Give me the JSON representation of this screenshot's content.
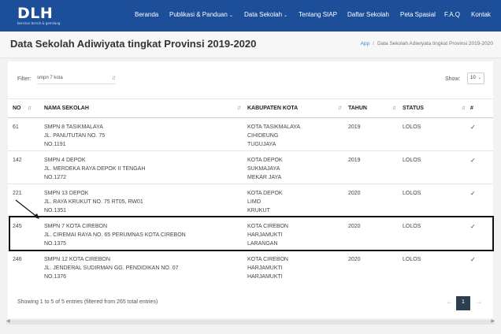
{
  "navbar": {
    "logo_main": "DLH",
    "logo_sub": "bersinar bersih & gemilang",
    "items": [
      {
        "label": "Beranda",
        "dropdown": false
      },
      {
        "label": "Publikasi & Panduan",
        "dropdown": true
      },
      {
        "label": "Data Sekolah",
        "dropdown": true
      },
      {
        "label": "Tentang SIAP",
        "dropdown": false
      },
      {
        "label": "Daftar Sekolah",
        "dropdown": false
      },
      {
        "label": "Peta Spasial",
        "dropdown": false
      },
      {
        "label": "F.A.Q",
        "dropdown": false
      },
      {
        "label": "Kontak",
        "dropdown": false
      }
    ]
  },
  "header": {
    "title": "Data Sekolah Adiwiyata tingkat Provinsi 2019-2020",
    "breadcrumb": [
      "App",
      "Data Sekolah Adiwiyata tingkat Provinsi 2019-2020"
    ]
  },
  "filter": {
    "label": "Filter:",
    "value": "smpn 7 kota"
  },
  "show": {
    "label": "Show:",
    "value": "10"
  },
  "table": {
    "headers": [
      "NO",
      "NAMA SEKOLAH",
      "KABUPATEN KOTA",
      "TAHUN",
      "STATUS",
      "#"
    ],
    "rows": [
      {
        "no": "61",
        "name": [
          "SMPN 8 TASIKMALAYA",
          "JL. PANUTUTAN NO. 75",
          "NO.1191"
        ],
        "kab": [
          "KOTA TASIKMALAYA",
          "CIHIDEUNG",
          "TUGUJAYA"
        ],
        "tahun": "2019",
        "status": "LOLOS",
        "icon": "✓"
      },
      {
        "no": "142",
        "name": [
          "SMPN 4 DEPOK",
          "JL. MERDEKA RAYA DEPOK II TENGAH",
          "NO.1272"
        ],
        "kab": [
          "KOTA DEPOK",
          "SUKMAJAYA",
          "MEKAR JAYA"
        ],
        "tahun": "2019",
        "status": "LOLOS",
        "icon": "✓"
      },
      {
        "no": "221",
        "name": [
          "SMPN 13 DEPOK",
          "JL. RAYA KRUKUT NO. 75 RT05, RW01",
          "NO.1351"
        ],
        "kab": [
          "KOTA DEPOK",
          "LIMO",
          "KRUKUT"
        ],
        "tahun": "2020",
        "status": "LOLOS",
        "icon": "✓"
      },
      {
        "no": "245",
        "name": [
          "SMPN 7 KOTA CIREBON",
          "JL. CIREMAI RAYA NO. 65 PERUMNAS KOTA CIREBON",
          "NO.1375"
        ],
        "kab": [
          "KOTA CIREBON",
          "HARJAMUKTI",
          "LARANGAN"
        ],
        "tahun": "2020",
        "status": "LOLOS",
        "icon": "✓"
      },
      {
        "no": "246",
        "name": [
          "SMPN 12 KOTA CIREBON",
          "JL. JENDERAL SUDIRMAN GG. PENDIDIKAN NO. 07",
          "NO.1376"
        ],
        "kab": [
          "KOTA CIREBON",
          "HARJAMUKTI",
          "HARJAMUKTI"
        ],
        "tahun": "2020",
        "status": "LOLOS",
        "icon": "✓"
      }
    ]
  },
  "footer": {
    "showing": "Showing 1 to 5 of 5 entries (filtered from 265 total entries)",
    "pagination": {
      "prev": "←",
      "current": "1",
      "next": "→"
    }
  },
  "colors": {
    "navbar": "#1c4e99",
    "logo_accent": "#f5c518",
    "page_active": "#2c3e50"
  }
}
